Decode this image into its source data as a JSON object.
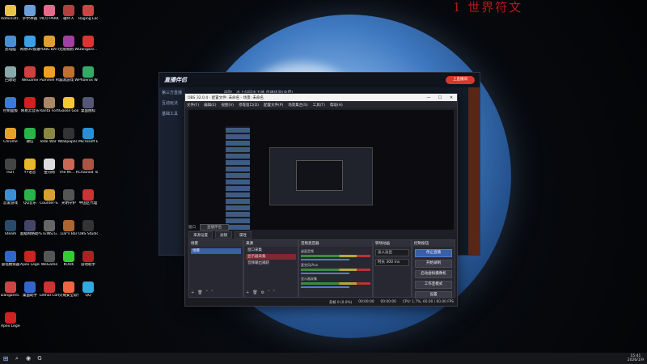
{
  "watermark": "1 世界符文",
  "desktop_icons": [
    {
      "label": "Administr...",
      "color": "#e8c34a"
    },
    {
      "label": "护尔神器",
      "color": "#6a9fd8"
    },
    {
      "label": "PICO PARK 2",
      "color": "#e86a8a"
    },
    {
      "label": "破坏人",
      "color": "#b34040"
    },
    {
      "label": "Raging Loop",
      "color": "#c44"
    },
    {
      "label": "此电脑",
      "color": "#4a8fd6"
    },
    {
      "label": "网易UU加速",
      "color": "#3aa0e8"
    },
    {
      "label": "PUBG BATTLEGR...",
      "color": "#e0a030"
    },
    {
      "label": "无限规则 WeGame版",
      "color": "#a040a0"
    },
    {
      "label": "Danganr... Trigger H...",
      "color": "#d33"
    },
    {
      "label": "回收站",
      "color": "#8aa"
    },
    {
      "label": "WeGame",
      "color": "#d04040"
    },
    {
      "label": "Pummel Party",
      "color": "#f0a020"
    },
    {
      "label": "漏洞游戏 WeGame版",
      "color": "#c07030"
    },
    {
      "label": "Phoenix Wright A...",
      "color": "#3a6"
    },
    {
      "label": "控制面板",
      "color": "#3a7ad8"
    },
    {
      "label": "网易云音乐",
      "color": "#d02020"
    },
    {
      "label": "Ranta Fortune ...",
      "color": "#a86"
    },
    {
      "label": "Goose Goose Duck",
      "color": "#f6c830"
    },
    {
      "label": "桌面图标",
      "color": "#557"
    },
    {
      "label": "Chrome",
      "color": "#e5a228"
    },
    {
      "label": "微信",
      "color": "#2ab34a"
    },
    {
      "label": "Total War THREE K...",
      "color": "#884"
    },
    {
      "label": "Wallpaper...",
      "color": "#333"
    },
    {
      "label": "Microsoft Edge",
      "color": "#2b8fd8"
    },
    {
      "label": "HDT",
      "color": "#444"
    },
    {
      "label": "YY语音",
      "color": "#e8b82a"
    },
    {
      "label": "金舟网",
      "color": "#ddd"
    },
    {
      "label": "The Mi... Rabbit Ma...",
      "color": "#c65"
    },
    {
      "label": "Chained Together",
      "color": "#a54"
    },
    {
      "label": "恋爱游戏",
      "color": "#3a90d8"
    },
    {
      "label": "QQ音乐",
      "color": "#2ab34a"
    },
    {
      "label": "Counter-S... 2",
      "color": "#d8a030"
    },
    {
      "label": "光明守护",
      "color": "#555"
    },
    {
      "label": "中国区代理",
      "color": "#c33"
    },
    {
      "label": "Steam",
      "color": "#2a4a6a"
    },
    {
      "label": "超级网络助手",
      "color": "#446"
    },
    {
      "label": "STEINS;G...",
      "color": "#666"
    },
    {
      "label": "Liar's Bar",
      "color": "#a63"
    },
    {
      "label": "OBS Studio",
      "color": "#333"
    },
    {
      "label": "雷电模拟器",
      "color": "#36c"
    },
    {
      "label": "Apex Legends",
      "color": "#c22"
    },
    {
      "label": "WeGame",
      "color": "#555"
    },
    {
      "label": "KOOK",
      "color": "#3c3"
    },
    {
      "label": "游戏助手",
      "color": "#a22"
    },
    {
      "label": "Danganro... 2 Goodb...",
      "color": "#c44"
    },
    {
      "label": "桌面助手",
      "color": "#36c"
    },
    {
      "label": "Lethal Company",
      "color": "#c33"
    },
    {
      "label": "火绒安全软件",
      "color": "#e64"
    },
    {
      "label": "QQ",
      "color": "#3ad"
    },
    {
      "label": "Apex Legends",
      "color": "#c22"
    }
  ],
  "back_window": {
    "logo": "直播伴侣",
    "live_button": "上直播间",
    "notice": "提取、不上站回不下播 直播体验(全屏)",
    "sidebar": [
      "第三方直播",
      "互动玩法",
      "基础工具"
    ]
  },
  "obs": {
    "title": "OBS 32.0.4 - 配置文件: 未命名 - 场景: 未命名",
    "controls": [
      "—",
      "☐",
      "✕"
    ],
    "menu": [
      "文件(F)",
      "编辑(E)",
      "视图(V)",
      "停靠窗口(D)",
      "配置文件(P)",
      "场景集合(S)",
      "工具(T)",
      "帮助(H)"
    ],
    "preview_bar": {
      "source": "窗口",
      "selected": "直播伴侣"
    },
    "tabs": [
      "来源设置",
      "滤镜",
      "属性"
    ],
    "scenes": {
      "title": "场景",
      "items": [
        "场景"
      ]
    },
    "sources": {
      "title": "来源",
      "items": [
        {
          "name": "窗口采集",
          "active": false
        },
        {
          "name": "显示器采集",
          "active": true
        },
        {
          "name": "音频输出捕获",
          "active": false
        }
      ]
    },
    "mixer": {
      "title": "音频混音器",
      "channels": [
        {
          "name": "桌面音频",
          "db": "0.0 dB"
        },
        {
          "name": "麦克风/Aux",
          "db": "0.0 dB"
        },
        {
          "name": "显示器采集",
          "db": "0.0 dB"
        }
      ]
    },
    "transitions": {
      "title": "转场动画",
      "type": "淡入淡出",
      "duration_label": "时长",
      "duration": "300 ms"
    },
    "controls_dock": {
      "title": "控制按钮",
      "buttons": [
        "停止直播",
        "开始录制",
        "启动虚拟摄像机",
        "工作室模式",
        "设置"
      ]
    },
    "status": {
      "dropped": "丢帧 0 (0.0%)",
      "live": "00:00:00",
      "rec": "00:00:00",
      "cpu": "CPU: 1.7%, 60.00 / 60.00 FPS"
    }
  },
  "taskbar": {
    "apps": [
      "⊞",
      "⌕",
      "◉",
      "G"
    ],
    "time": "15:41",
    "date": "2026/1/9"
  }
}
